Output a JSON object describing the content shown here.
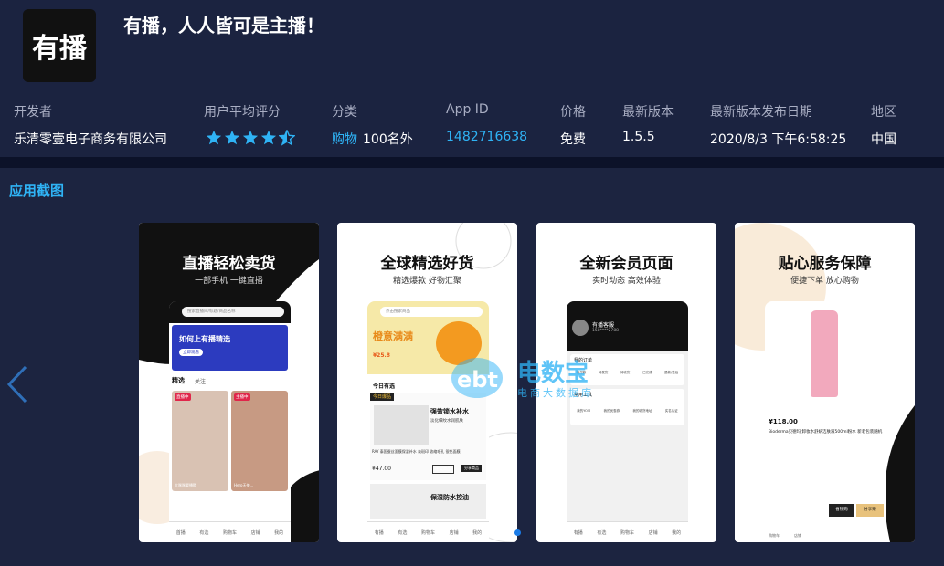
{
  "app": {
    "icon_text": "有播",
    "title": "有播，人人皆可是主播！"
  },
  "meta": {
    "labels": {
      "developer": "开发者",
      "rating": "用户平均评分",
      "category": "分类",
      "app_id": "App ID",
      "price": "价格",
      "version": "最新版本",
      "release_date": "最新版本发布日期",
      "region": "地区"
    },
    "values": {
      "developer": "乐清零壹电子商务有限公司",
      "rating_stars": 4.5,
      "category": "购物",
      "category_rank": "100名外",
      "app_id": "1482716638",
      "price": "免费",
      "version": "1.5.5",
      "release_date": "2020/8/3 下午6:58:25",
      "region": "中国"
    }
  },
  "section_title": "应用截图",
  "screenshots": [
    {
      "title": "直播轻松卖货",
      "subtitle": "一部手机 一键直播",
      "search_placeholder": "搜索直播间/标题/商品名称",
      "banner": "如何上有播精选",
      "banner_btn": "立即观看",
      "tabs": [
        "精选",
        "关注"
      ],
      "live_badges": [
        "直播中",
        "主播中"
      ],
      "streamers": [
        "大咪咪要播酷",
        "Hero天使..."
      ],
      "nav": [
        "首播",
        "有选",
        "购物车",
        "店铺",
        "我的"
      ]
    },
    {
      "title": "全球精选好货",
      "subtitle": "精选爆款 好物汇聚",
      "search_placeholder": "点击搜索商品",
      "banner": "橙意满满",
      "price_tag": "¥25.8",
      "section": "今日有选",
      "product_badge": "今日爆品",
      "product_title": "强效锁水补水",
      "product_sub": "淡化细纹水润肌肤",
      "product_desc": "RAY 泰国蚕丝面膜保湿补水 淡斑印 收缩毛孔 银色面膜",
      "price": "¥47.00",
      "buttons": [
        "上架商品",
        "分享商品"
      ],
      "product2": "保湿防水控油",
      "nav": [
        "有播",
        "有选",
        "购物车",
        "店铺",
        "我的"
      ]
    },
    {
      "title": "全新会员页面",
      "subtitle": "实时动态 高效体验",
      "user": "有播客服",
      "user_id": "158****2788",
      "orders_label": "我的订单",
      "orders": [
        "待付款",
        "待发货",
        "待收货",
        "已完成",
        "退款/售后"
      ],
      "services_label": "常用工具",
      "services": [
        "我的YO币",
        "我的优惠券",
        "我的收货地址",
        "实名认证"
      ],
      "nav": [
        "有播",
        "有选",
        "购物车",
        "店铺",
        "我的"
      ]
    },
    {
      "title": "贴心服务保障",
      "subtitle": "便捷下单 放心购物",
      "price": "¥118.00",
      "product": "Bioderma贝德玛 卸妆水舒妍洁肤液500ml粉水 新老包装随机",
      "buttons": [
        "省钱购",
        "分享赚"
      ],
      "nav": [
        "购物车",
        "店铺"
      ]
    }
  ],
  "watermark": {
    "brand": "电数宝",
    "sub": "电商大数据库"
  },
  "colors": {
    "accent": "#2fb3f5",
    "background": "#1c2440",
    "star": "#2fb3f5"
  }
}
